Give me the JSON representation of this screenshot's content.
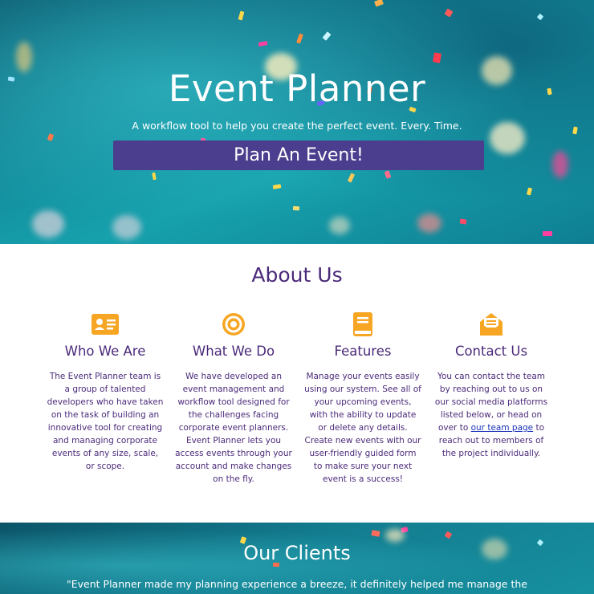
{
  "hero": {
    "title": "Event Planner",
    "subtitle": "A workflow tool to help you create the perfect event. Every. Time.",
    "cta_label": "Plan An Event!"
  },
  "about": {
    "title": "About Us",
    "columns": [
      {
        "icon": "id-card-icon",
        "heading": "Who We Are",
        "text": "The Event Planner team is a group of talented developers who have taken on the task of building an innovative tool for creating and managing corporate events of any size, scale, or scope."
      },
      {
        "icon": "target-icon",
        "heading": "What We Do",
        "text": "We have developed an event management and workflow tool designed for the challenges facing corporate event planners. Event Planner lets you access events through your account and make changes on the fly."
      },
      {
        "icon": "book-icon",
        "heading": "Features",
        "text": "Manage your events easily using our system. See all of your upcoming events, with the ability to update or delete any details. Create new events with our user-friendly guided form to make sure your next event is a success!"
      },
      {
        "icon": "envelope-open-icon",
        "heading": "Contact Us",
        "text_before": "You can contact the team by reaching out to us on our social media platforms listed below, or head on over to ",
        "link": "our team page",
        "text_after": " to reach out to members of the project individually."
      }
    ]
  },
  "clients": {
    "title": "Our Clients",
    "quote": "\"Event Planner made my planning experience a breeze, it definitely helped me manage the"
  },
  "colors": {
    "accent": "#f6a623",
    "heading_purple": "#4b2a7a",
    "cta_purple": "#4b3e8e",
    "teal": "#16a1ad"
  }
}
